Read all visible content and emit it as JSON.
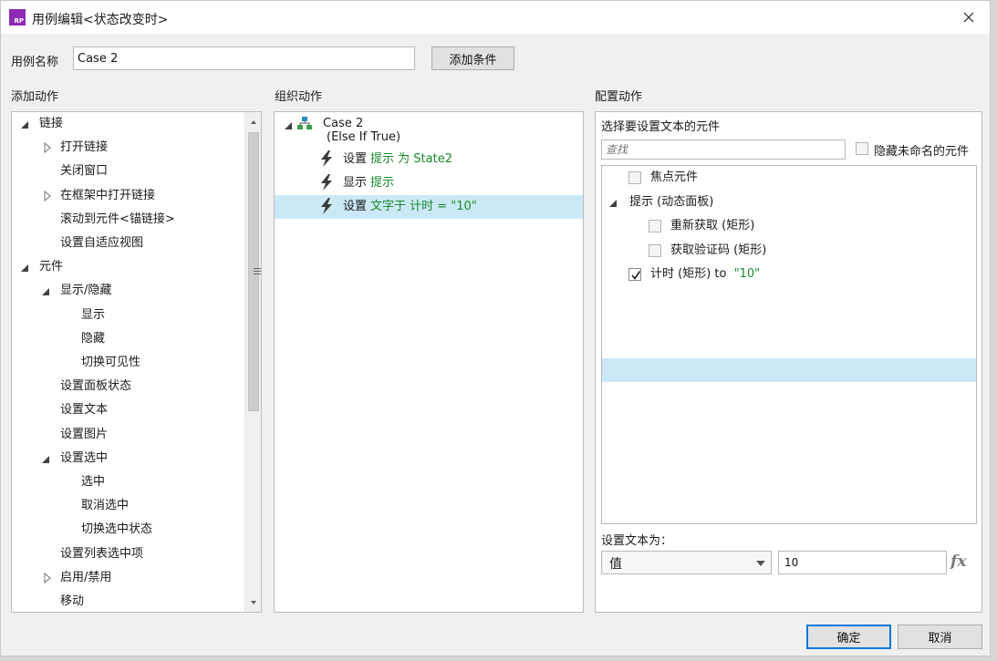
{
  "window": {
    "title": "用例编辑<状态改变时>",
    "app_icon_text": "RP",
    "accent": "#8e2bb5"
  },
  "case_name": {
    "label": "用例名称",
    "value": "Case 2",
    "add_condition": "添加条件"
  },
  "add_action": {
    "heading": "添加动作",
    "items": [
      {
        "label": "链接",
        "indent": 0,
        "toggle": "open"
      },
      {
        "label": "打开链接",
        "indent": 1,
        "toggle": "closed"
      },
      {
        "label": "关闭窗口",
        "indent": 1,
        "toggle": "none"
      },
      {
        "label": "在框架中打开链接",
        "indent": 1,
        "toggle": "closed"
      },
      {
        "label": "滚动到元件<锚链接>",
        "indent": 1,
        "toggle": "none"
      },
      {
        "label": "设置自适应视图",
        "indent": 1,
        "toggle": "none"
      },
      {
        "label": "元件",
        "indent": 0,
        "toggle": "open"
      },
      {
        "label": "显示/隐藏",
        "indent": 1,
        "toggle": "open"
      },
      {
        "label": "显示",
        "indent": 2,
        "toggle": "none"
      },
      {
        "label": "隐藏",
        "indent": 2,
        "toggle": "none"
      },
      {
        "label": "切换可见性",
        "indent": 2,
        "toggle": "none"
      },
      {
        "label": "设置面板状态",
        "indent": 1,
        "toggle": "none"
      },
      {
        "label": "设置文本",
        "indent": 1,
        "toggle": "none"
      },
      {
        "label": "设置图片",
        "indent": 1,
        "toggle": "none"
      },
      {
        "label": "设置选中",
        "indent": 1,
        "toggle": "open"
      },
      {
        "label": "选中",
        "indent": 2,
        "toggle": "none"
      },
      {
        "label": "取消选中",
        "indent": 2,
        "toggle": "none"
      },
      {
        "label": "切换选中状态",
        "indent": 2,
        "toggle": "none"
      },
      {
        "label": "设置列表选中项",
        "indent": 1,
        "toggle": "none"
      },
      {
        "label": "启用/禁用",
        "indent": 1,
        "toggle": "closed"
      },
      {
        "label": "移动",
        "indent": 1,
        "toggle": "none"
      }
    ]
  },
  "organize": {
    "heading": "组织动作",
    "case_title": "Case 2",
    "case_condition": "(Else If True)",
    "actions": [
      {
        "verb": "设置",
        "detail": "提示 为 State2",
        "selected": false
      },
      {
        "verb": "显示",
        "detail": "提示",
        "selected": false
      },
      {
        "verb": "设置",
        "detail": "文字于 计时 = \"10\"",
        "selected": true
      }
    ]
  },
  "configure": {
    "heading": "配置动作",
    "subheading": "选择要设置文本的元件",
    "search_placeholder": "查找",
    "hide_unnamed": "隐藏未命名的元件",
    "elements": [
      {
        "label": "焦点元件",
        "suffix": "",
        "checked": false,
        "indent": 1,
        "group": false
      },
      {
        "label": "提示 (动态面板)",
        "suffix": "",
        "checked": false,
        "indent": 0,
        "group": true
      },
      {
        "label": "重新获取 (矩形)",
        "suffix": "",
        "checked": false,
        "indent": 2,
        "group": false
      },
      {
        "label": "获取验证码 (矩形)",
        "suffix": "",
        "checked": false,
        "indent": 2,
        "group": false
      },
      {
        "label": "计时 (矩形) to ",
        "suffix": "\"10\"",
        "checked": true,
        "indent": 1,
        "group": false,
        "selected": true
      }
    ],
    "set_text_label": "设置文本为：",
    "type_value": "值",
    "text_value": "10",
    "fx": "fx"
  },
  "footer": {
    "ok": "确定",
    "cancel": "取消"
  }
}
